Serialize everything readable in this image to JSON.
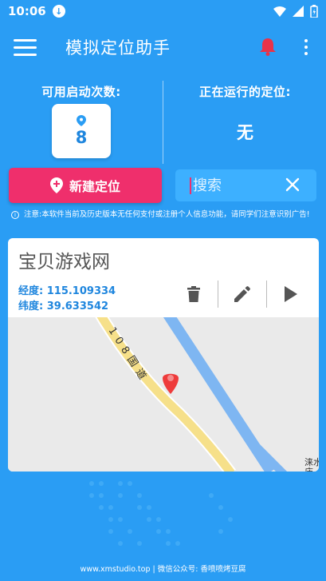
{
  "status_bar": {
    "time": "10:06"
  },
  "app_bar": {
    "title": "模拟定位助手"
  },
  "left_panel": {
    "label": "可用启动次数:",
    "count": "8"
  },
  "right_panel": {
    "label": "正在运行的定位:",
    "value": "无"
  },
  "new_button": {
    "label": "新建定位"
  },
  "search": {
    "placeholder": "搜索",
    "value": ""
  },
  "notice": "注意:本软件当前及历史版本无任何支付或注册个人信息功能，请同学们注意识别广告!",
  "location_card": {
    "title": "宝贝游戏网",
    "longitude_label": "经度:",
    "longitude": "115.109334",
    "latitude_label": "纬度:",
    "latitude": "39.633542"
  },
  "map": {
    "road_label": "108国道",
    "place_label": "涞水",
    "place_label_2": "庙"
  },
  "footer": "www.xmstudio.top | 微信公众号: 香喷喷烤豆腐",
  "colors": {
    "background": "#2a9df4",
    "accent_pink": "#ef2f6c",
    "accent_blue": "#1f86de",
    "bell_red": "#e8334a"
  }
}
